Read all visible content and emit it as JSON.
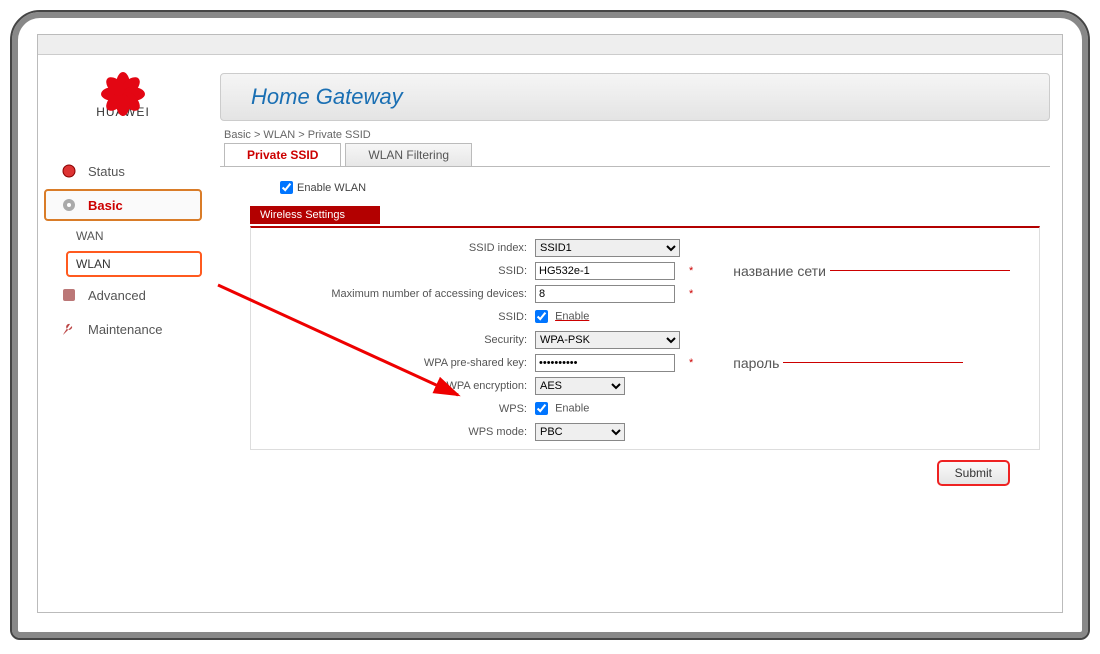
{
  "brand": "HUAWEI",
  "title": "Home Gateway",
  "breadcrumb": "Basic > WLAN > Private SSID",
  "tabs": {
    "private": "Private SSID",
    "filtering": "WLAN Filtering"
  },
  "nav": {
    "status": "Status",
    "basic": "Basic",
    "wan": "WAN",
    "wlan": "WLAN",
    "advanced": "Advanced",
    "maintenance": "Maintenance"
  },
  "enable_wlan_label": "Enable WLAN",
  "section": "Wireless Settings",
  "labels": {
    "ssid_index": "SSID index:",
    "ssid": "SSID:",
    "max_dev": "Maximum number of accessing devices:",
    "ssid_en": "SSID:",
    "security": "Security:",
    "psk": "WPA pre-shared key:",
    "enc": "WPA encryption:",
    "wps": "WPS:",
    "wps_mode": "WPS mode:"
  },
  "values": {
    "ssid_index": "SSID1",
    "ssid": "HG532e-1",
    "max_dev": "8",
    "enable": "Enable",
    "security": "WPA-PSK",
    "psk": "••••••••••",
    "enc": "AES",
    "wps_mode": "PBC"
  },
  "notes": {
    "name": "название сети",
    "password": "пароль"
  },
  "submit": "Submit"
}
